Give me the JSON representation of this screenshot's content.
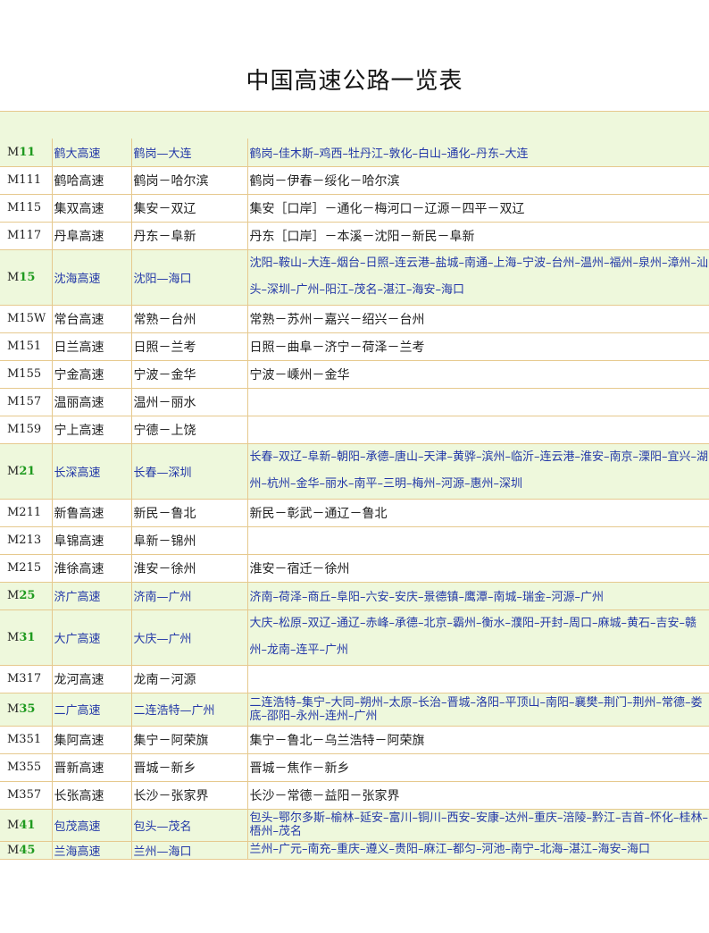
{
  "title": "中国高速公路一览表",
  "rows": [
    {
      "pre": "M",
      "num": "11",
      "name": "鹤大高速",
      "span": "鹤岗—大连",
      "route": "鹤岗–佳木斯–鸡西–牡丹江–敦化–白山–通化–丹东–大连"
    },
    {
      "code": "M111",
      "name": "鹤哈高速",
      "span": "鹤岗－哈尔滨",
      "route": "鹤岗－伊春－绥化－哈尔滨"
    },
    {
      "code": "M115",
      "name": "集双高速",
      "span": "集安－双辽",
      "route": "集安［口岸］－通化－梅河口－辽源－四平－双辽"
    },
    {
      "code": "M117",
      "name": "丹阜高速",
      "span": "丹东－阜新",
      "route": "丹东［口岸］－本溪－沈阳－新民－阜新"
    },
    {
      "pre": "M",
      "num": "15",
      "name": "沈海高速",
      "span": "沈阳—海口",
      "route": "沈阳–鞍山–大连–烟台–日照–连云港–盐城–南通–上海–宁波–台州–温州–福州–泉州–漳州–汕头–深圳–广州–阳江–茂名–湛江–海安–海口"
    },
    {
      "code": "M15W",
      "name": "常台高速",
      "span": "常熟－台州",
      "route": "常熟－苏州－嘉兴－绍兴－台州"
    },
    {
      "code": "M151",
      "name": "日兰高速",
      "span": "日照－兰考",
      "route": "日照－曲阜－济宁－荷泽－兰考"
    },
    {
      "code": "M155",
      "name": "宁金高速",
      "span": "宁波－金华",
      "route": "宁波－嵊州－金华"
    },
    {
      "code": "M157",
      "name": "温丽高速",
      "span": "温州－丽水",
      "route": ""
    },
    {
      "code": "M159",
      "name": "宁上高速",
      "span": "宁德－上饶",
      "route": ""
    },
    {
      "pre": "M",
      "num": "21",
      "name": "长深高速",
      "span": "长春—深圳",
      "route": "长春–双辽–阜新–朝阳–承德–唐山–天津–黄骅–滨州–临沂–连云港–淮安–南京–溧阳–宜兴–湖州–杭州–金华–丽水–南平–三明–梅州–河源–惠州–深圳"
    },
    {
      "code": "M211",
      "name": "新鲁高速",
      "span": "新民－鲁北",
      "route": "新民－彰武－通辽－鲁北"
    },
    {
      "code": "M213",
      "name": "阜锦高速",
      "span": "阜新－锦州",
      "route": ""
    },
    {
      "code": "M215",
      "name": "淮徐高速",
      "span": "淮安－徐州",
      "route": "淮安－宿迁－徐州"
    },
    {
      "pre": "M",
      "num": "25",
      "name": "济广高速",
      "span": "济南—广州",
      "route": "济南–荷泽–商丘–阜阳–六安–安庆–景德镇–鹰潭–南城–瑞金–河源–广州"
    },
    {
      "pre": "M",
      "num": "31",
      "name": "大广高速",
      "span": "大庆—广州",
      "route": "大庆–松原–双辽–通辽–赤峰–承德–北京–霸州–衡水–濮阳–开封–周口–麻城–黄石–吉安–赣州–龙南–连平–广州"
    },
    {
      "code": "M317",
      "name": "龙河高速",
      "span": "龙南－河源",
      "route": ""
    },
    {
      "pre": "M",
      "num": "35",
      "name": "二广高速",
      "span": "二连浩特—广州",
      "route": "二连浩特–集宁–大同–朔州–太原–长治–晋城–洛阳–平顶山–南阳–襄樊–荆门–荆州–常德–娄底–邵阳–永州–连州–广州"
    },
    {
      "code": "M351",
      "name": "集阿高速",
      "span": "集宁－阿荣旗",
      "route": "集宁－鲁北－乌兰浩特－阿荣旗"
    },
    {
      "code": "M355",
      "name": "晋新高速",
      "span": "晋城－新乡",
      "route": "晋城－焦作－新乡"
    },
    {
      "code": "M357",
      "name": "长张高速",
      "span": "长沙－张家界",
      "route": "长沙－常德－益阳－张家界"
    },
    {
      "pre": "M",
      "num": "41",
      "name": "包茂高速",
      "span": "包头—茂名",
      "route": "包头–鄂尔多斯–榆林–延安–富川–铜川–西安–安康–达州–重庆–涪陵–黔江–吉首–怀化–桂林–梧州–茂名"
    },
    {
      "pre": "M",
      "num": "45",
      "name": "兰海高速",
      "span": "兰州—海口",
      "route": "兰州–广元–南充–重庆–遵义–贵阳–麻江–都匀–河池–南宁–北海–湛江–海安–海口"
    }
  ]
}
